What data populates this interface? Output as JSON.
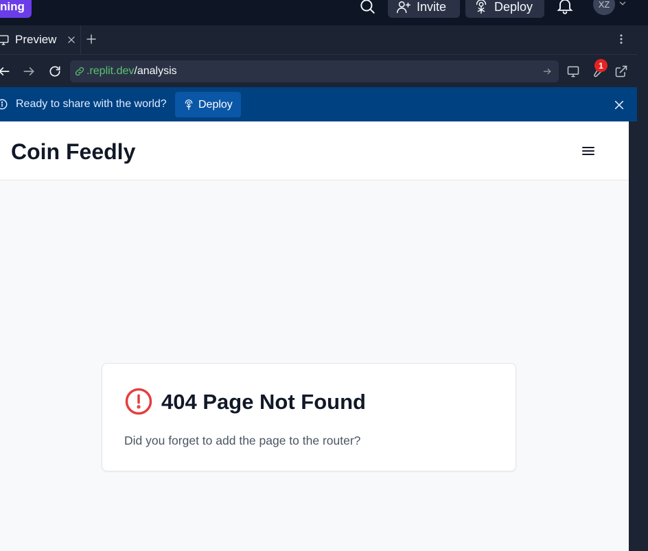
{
  "topbar": {
    "run_badge": "ning",
    "invite_label": "Invite",
    "deploy_label": "Deploy",
    "avatar_initials": "XZ"
  },
  "tabs": [
    {
      "label": "Preview"
    }
  ],
  "urlbar": {
    "domain": ".replit.dev",
    "path": "/analysis",
    "notification_count": "1"
  },
  "banner": {
    "message": "Ready to share with the world?",
    "deploy_label": "Deploy"
  },
  "app": {
    "title": "Coin Feedly",
    "error_title": "404 Page Not Found",
    "error_message": "Did you forget to add the page to the router?"
  },
  "colors": {
    "badge_purple": "#6a3de8",
    "banner_blue": "#004182",
    "url_green": "#58c472",
    "alert_red": "#e53e3e",
    "notif_red": "#e52222"
  }
}
